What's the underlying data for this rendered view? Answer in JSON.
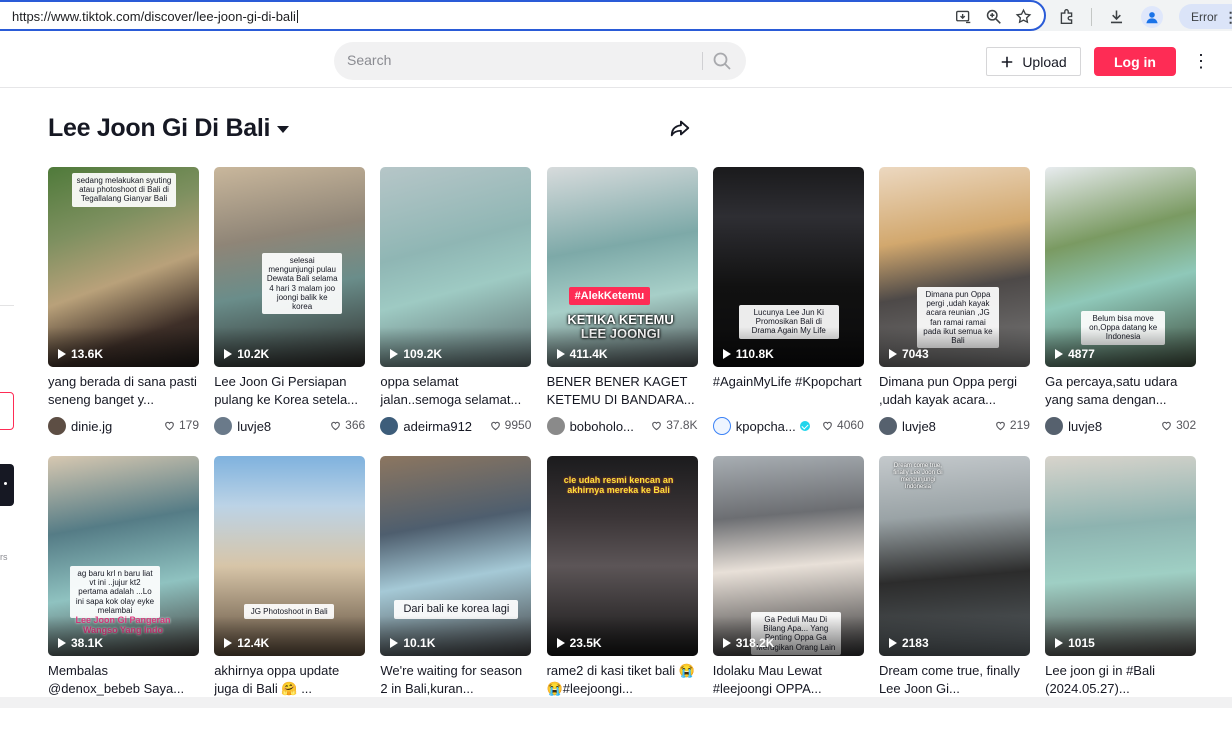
{
  "browser": {
    "url": "https://www.tiktok.com/discover/lee-joon-gi-di-bali",
    "error_label": "Error"
  },
  "header": {
    "search_placeholder": "Search",
    "upload_label": "Upload",
    "login_label": "Log in"
  },
  "page": {
    "title": "Lee Joon Gi Di Bali"
  },
  "colors": {
    "brand": "#fe2c55",
    "text": "#161823",
    "muted": "#57575d"
  },
  "videos": [
    {
      "views": "13.6K",
      "caption": "yang berada di sana pasti seneng banget y...",
      "user": "dinie.jg",
      "likes": "179",
      "overlay": "sedang melakukan syuting atau photoshoot di Bali di Tegallalang Gianyar Bali"
    },
    {
      "views": "10.2K",
      "caption": "Lee Joon Gi Persiapan pulang ke Korea setela...",
      "user": "luvje8",
      "likes": "366",
      "overlay": "selesai mengunjungi pulau Dewata Bali selama 4 hari 3 malam joo joongi balik ke korea"
    },
    {
      "views": "109.2K",
      "caption": "oppa selamat jalan..semoga selamat...",
      "user": "adeirma912",
      "likes": "9950",
      "overlay": ""
    },
    {
      "views": "411.4K",
      "caption": "BENER BENER KAGET KETEMU DI BANDARA...",
      "user": "boboholo...",
      "likes": "37.8K",
      "overlay": "#AlekKetemu",
      "overlay2": "KETIKA KETEMU LEE JOONGI"
    },
    {
      "views": "110.8K",
      "caption": "#AgainMyLife #Kpopchart",
      "user": "kpopcha...",
      "likes": "4060",
      "verified": true,
      "overlay": "Lucunya Lee Jun Ki Promosikan Bali di Drama Again My Life"
    },
    {
      "views": "7043",
      "caption": "Dimana pun Oppa pergi ,udah kayak acara...",
      "user": "luvje8",
      "likes": "219",
      "overlay": "Dimana pun Oppa pergi ,udah kayak acara reunian ,JG fan ramai ramai pada ikut semua ke Bali"
    },
    {
      "views": "4877",
      "caption": "Ga percaya,satu udara yang sama dengan...",
      "user": "luvje8",
      "likes": "302",
      "overlay": "Belum bisa move on,Oppa datang ke Indonesia"
    },
    {
      "views": "38.1K",
      "caption": "Membalas @denox_bebeb Saya...",
      "user": "",
      "likes": "",
      "overlay": "ag baru krl n baru liat vt ini ..jujur kt2 pertama adalah ...Lo ini sapa kok olay eyke melambai",
      "overlay2": "Lee Joon Gi Pangeran Wangso Yang Indo"
    },
    {
      "views": "12.4K",
      "caption": "akhirnya oppa update juga di Bali 🤗 ...",
      "user": "",
      "likes": "",
      "overlay": "JG Photoshoot in Bali"
    },
    {
      "views": "10.1K",
      "caption": "We're waiting for season 2 in Bali,kuran...",
      "user": "",
      "likes": "",
      "overlay": "Dari bali ke korea lagi"
    },
    {
      "views": "23.5K",
      "caption": "rame2 di kasi tiket bali 😭😭#leejoongi...",
      "user": "",
      "likes": "",
      "overlay": "cle udah resmi kencan an akhirnya mereka ke Bali"
    },
    {
      "views": "318.2K",
      "caption": "Idolaku Mau Lewat #leejoongi OPPA...",
      "user": "",
      "likes": "",
      "overlay": "Ga Peduli Mau Di Bilang Apa... Yang Penting Oppa Ga Merugikan Orang Lain"
    },
    {
      "views": "2183",
      "caption": "Dream come true, finally Lee Joon Gi...",
      "user": "",
      "likes": "",
      "overlay": "Dream come true, finally Lee Joon Gi mengunjungi Indonesia"
    },
    {
      "views": "1015",
      "caption": "Lee joon gi in #Bali (2024.05.27)...",
      "user": "",
      "likes": "",
      "overlay": ""
    }
  ]
}
